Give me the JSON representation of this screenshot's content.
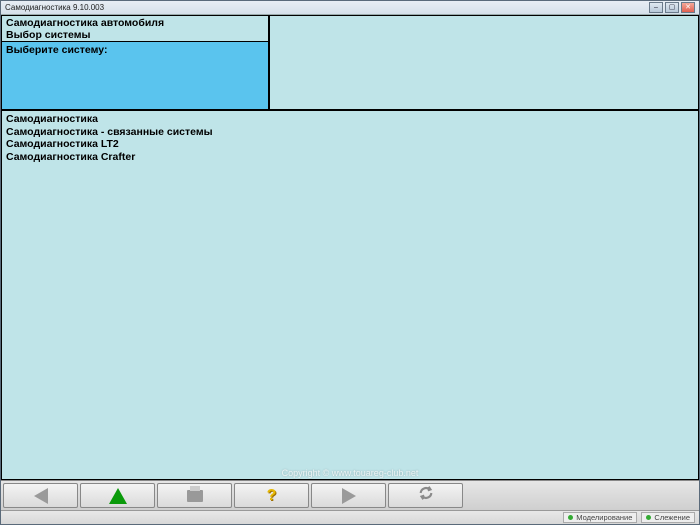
{
  "window": {
    "title": "Самодиагностика 9.10.003"
  },
  "header": {
    "line1": "Самодиагностика автомобиля",
    "line2": "Выбор системы",
    "prompt": "Выберите систему:"
  },
  "systems": [
    "Самодиагностика",
    "Самодиагностика - связанные системы",
    "Самодиагностика LT2",
    "Самодиагностика Crafter"
  ],
  "status": {
    "seg1": "Моделирование",
    "seg2": "Слежение"
  },
  "watermark": "Copyright © www.touareg-club.net"
}
